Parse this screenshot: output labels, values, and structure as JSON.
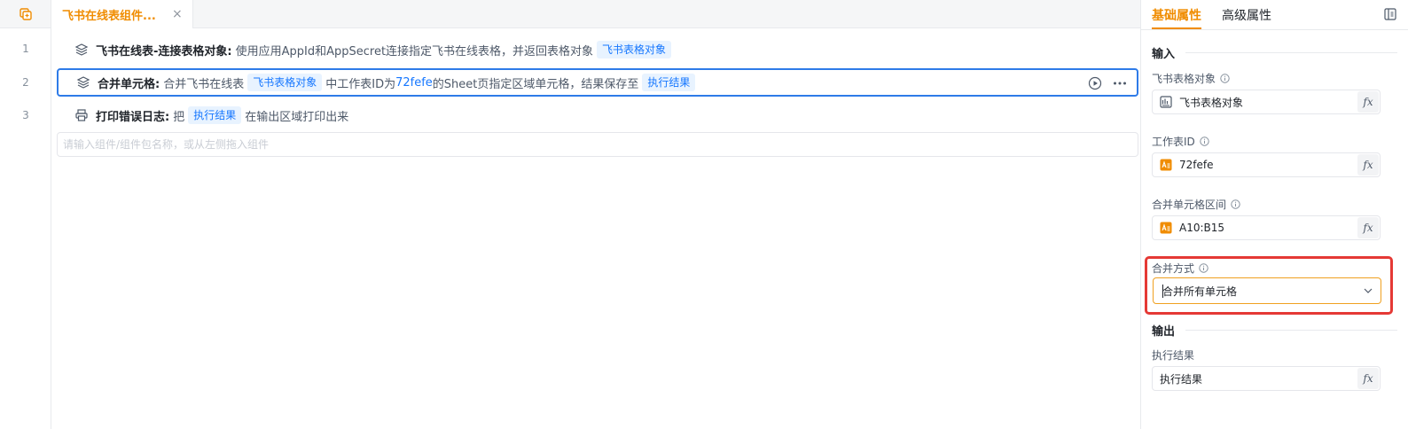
{
  "tab": {
    "label": "飞书在线表组件...",
    "close": "×"
  },
  "steps": [
    {
      "num": "1",
      "title": "飞书在线表-连接表格对象:",
      "text1": "使用应用AppId和AppSecret连接指定飞书在线表格，并返回表格对象",
      "chip1": "飞书表格对象"
    },
    {
      "num": "2",
      "title": "合并单元格:",
      "text1": "合并飞书在线表",
      "chip1": "飞书表格对象",
      "text2": "中工作表ID为",
      "value": "72fefe",
      "text3": "的Sheet页指定区域单元格，结果保存至",
      "chip2": "执行结果"
    },
    {
      "num": "3",
      "title": "打印错误日志:",
      "text1": "把",
      "chip1": "执行结果",
      "text2": "在输出区域打印出来"
    }
  ],
  "add_placeholder": "请输入组件/组件包名称，或从左侧拖入组件",
  "panel": {
    "tabs": {
      "basic": "基础属性",
      "advanced": "高级属性"
    },
    "input_section": "输入",
    "output_section": "输出",
    "fields": {
      "sheet_obj": {
        "label": "飞书表格对象",
        "value": "飞书表格对象"
      },
      "sheet_id": {
        "label": "工作表ID",
        "value": "72fefe"
      },
      "range": {
        "label": "合并单元格区间",
        "value": "A10:B15"
      },
      "merge_mode": {
        "label": "合并方式",
        "value": "合并所有单元格"
      },
      "result": {
        "label": "执行结果",
        "value": "执行结果"
      }
    },
    "fx": "fx"
  },
  "colors": {
    "accent": "#f08c00",
    "link": "#1677ff",
    "active_border": "#2e7be8",
    "highlight": "#e53935"
  }
}
